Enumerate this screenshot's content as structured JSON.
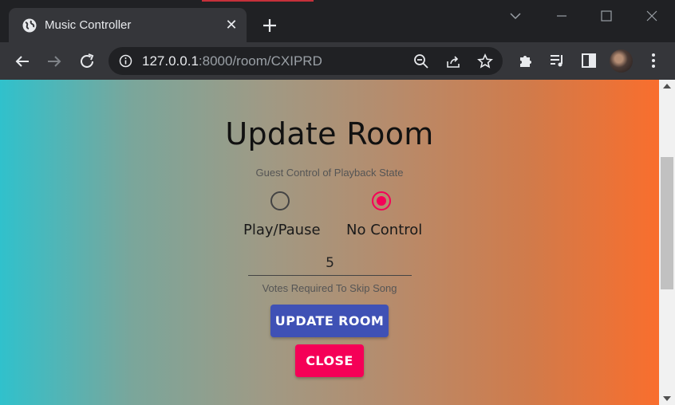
{
  "browser": {
    "tab_title": "Music Controller",
    "url_host": "127.0.0.1",
    "url_rest": ":8000/room/CXIPRD"
  },
  "icons": {
    "favicon": "globe-icon",
    "tab_close": "close-icon",
    "new_tab": "plus-icon",
    "back": "arrow-left-icon",
    "forward": "arrow-right-icon",
    "reload": "reload-icon",
    "site_info": "info-icon",
    "zoom": "zoom-out-icon",
    "share": "share-icon",
    "bookmark": "star-icon",
    "extensions": "puzzle-icon",
    "media": "media-queue-icon",
    "side_panel": "side-panel-icon",
    "menu": "more-vert-icon"
  },
  "page": {
    "title": "Update Room",
    "guest_control_label": "Guest Control of Playback State",
    "options": [
      {
        "label": "Play/Pause",
        "selected": false
      },
      {
        "label": "No Control",
        "selected": true
      }
    ],
    "votes_value": "5",
    "votes_helper": "Votes Required To Skip Song",
    "update_button": "UPDATE ROOM",
    "close_button": "CLOSE"
  },
  "colors": {
    "primary": "#3f51b5",
    "secondary": "#f50057",
    "gradient_start": "#30c1cc",
    "gradient_end": "#f96e2d"
  }
}
